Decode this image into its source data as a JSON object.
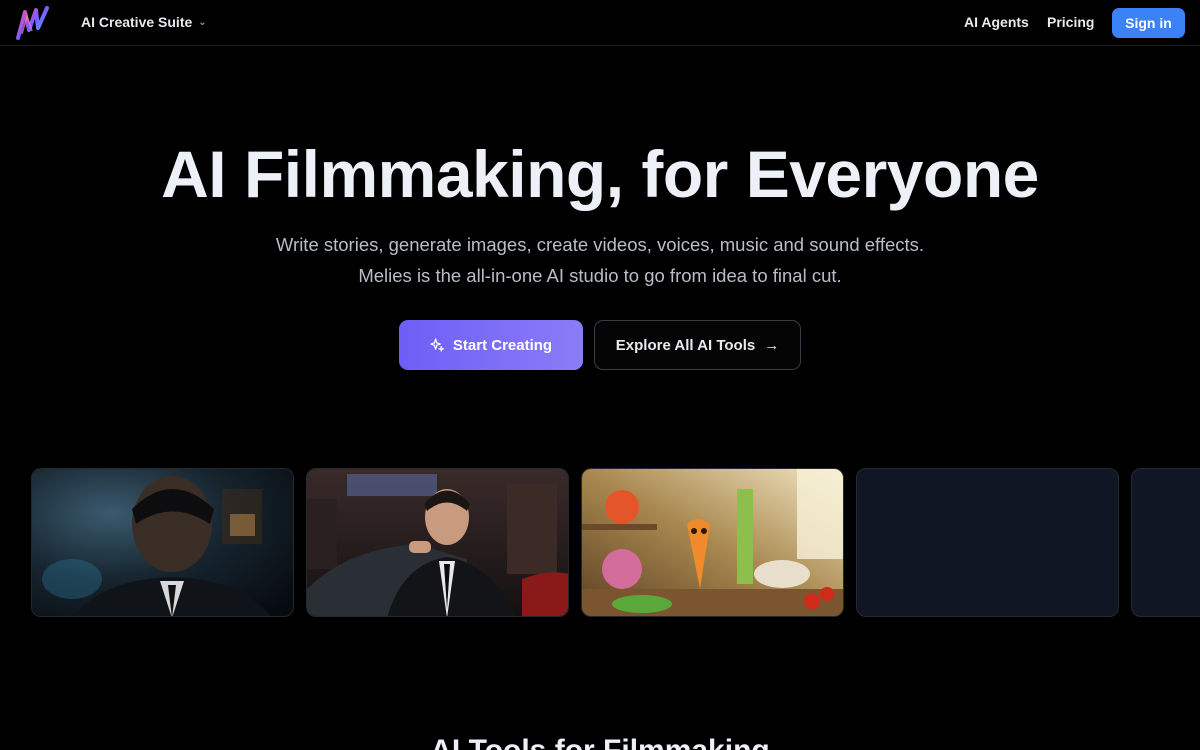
{
  "nav": {
    "brand_menu": "AI Creative Suite",
    "links": [
      "AI Agents",
      "Pricing"
    ],
    "signin_label": "Sign in"
  },
  "hero": {
    "title": "AI Filmmaking, for Everyone",
    "subtitle_line1": "Write stories, generate images, create videos, voices, music and sound effects.",
    "subtitle_line2": "Melies is the all-in-one AI studio to go from idea to final cut.",
    "primary_cta": "Start Creating",
    "secondary_cta": "Explore All AI Tools"
  },
  "showcase": {
    "cards": [
      "man-in-suit-portrait",
      "man-smoking-by-car",
      "animated-vegetables-kitchen",
      "empty-card",
      "empty-card"
    ]
  },
  "section": {
    "title": "AI Tools for Filmmaking"
  },
  "colors": {
    "accent_blue": "#3b82f6",
    "accent_purple": "#7c6cf7",
    "background": "#000000"
  }
}
